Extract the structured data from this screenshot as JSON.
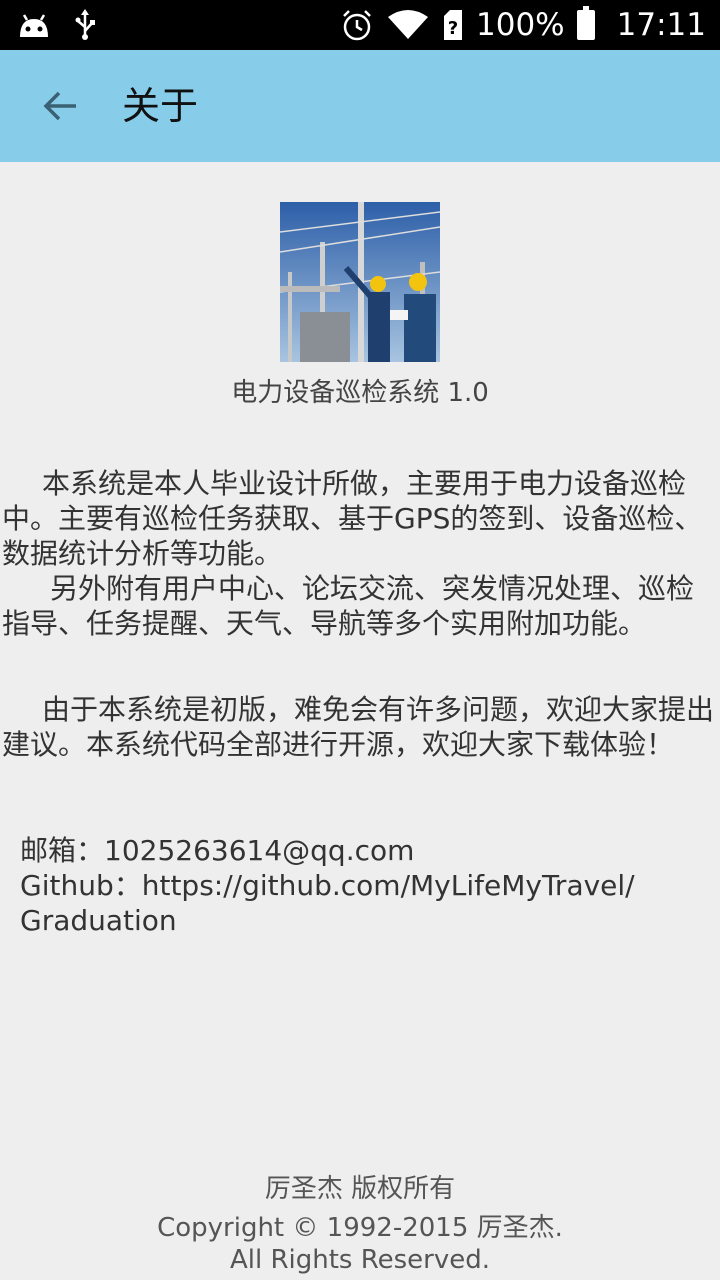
{
  "status_bar": {
    "battery": "100%",
    "time": "17:11"
  },
  "app_bar": {
    "back_icon": "arrow-left-icon",
    "title": "关于"
  },
  "about": {
    "app_name": "电力设备巡检系统 1.0",
    "paragraph1": "本系统是本人毕业设计所做，主要用于电力设备巡检中。主要有巡检任务获取、基于GPS的签到、设备巡检、数据统计分析等功能。",
    "paragraph2": "另外附有用户中心、论坛交流、突发情况处理、巡检指导、任务提醒、天气、导航等多个实用附加功能。",
    "paragraph3": "由于本系统是初版，难免会有许多问题，欢迎大家提出建议。本系统代码全部进行开源，欢迎大家下载体验！",
    "email_line": "邮箱：1025263614@qq.com",
    "github_line": "Github：https://github.com/MyLifeMyTravel/Graduation"
  },
  "footer": {
    "line1": "厉圣杰 版权所有",
    "line2": "Copyright © 1992-2015 厉圣杰.",
    "line3": "All Rights Reserved."
  },
  "colors": {
    "app_bar": "#87cdea",
    "background": "#eeeeee",
    "status_bar": "#000000"
  }
}
